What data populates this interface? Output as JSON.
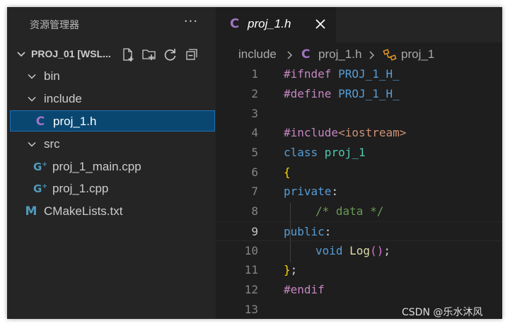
{
  "sidebar": {
    "title": "资源管理器",
    "more_label": "···",
    "section_title": "PROJ_01 [WSL...",
    "tree": [
      {
        "label": "bin",
        "type": "folder",
        "level": 1
      },
      {
        "label": "include",
        "type": "folder",
        "level": 1
      },
      {
        "label": "proj_1.h",
        "type": "c",
        "icon": "C",
        "level": 2,
        "selected": true
      },
      {
        "label": "src",
        "type": "folder",
        "level": 1
      },
      {
        "label": "proj_1_main.cpp",
        "type": "cpp",
        "icon": "G",
        "level": 2
      },
      {
        "label": "proj_1.cpp",
        "type": "cpp",
        "icon": "G",
        "level": 2
      },
      {
        "label": "CMakeLists.txt",
        "type": "cmake",
        "icon": "M",
        "level": 1
      }
    ]
  },
  "editor": {
    "tab": {
      "icon": "C",
      "label": "proj_1.h"
    },
    "breadcrumb": {
      "folder": "include",
      "file_icon": "C",
      "file": "proj_1.h",
      "symbol": "proj_1"
    },
    "current_line": 9,
    "lines": [
      {
        "n": "1"
      },
      {
        "n": "2"
      },
      {
        "n": "3"
      },
      {
        "n": "4"
      },
      {
        "n": "5"
      },
      {
        "n": "6"
      },
      {
        "n": "7"
      },
      {
        "n": "8"
      },
      {
        "n": "9"
      },
      {
        "n": "10"
      },
      {
        "n": "11"
      },
      {
        "n": "12"
      },
      {
        "n": "13"
      }
    ],
    "code": {
      "l1_pre": "#ifndef",
      "l1_mac": " PROJ_1_H_",
      "l2_pre": "#define",
      "l2_mac": " PROJ_1_H_",
      "l4_pre": "#include",
      "l4_str": "<iostream>",
      "l5_kw": "class",
      "l5_type": " proj_1",
      "l6_br": "{",
      "l7_kw": "private",
      "l7_colon": ":",
      "l8_com": "/* data */",
      "l9_kw": "public",
      "l9_colon": ":",
      "l10_kw": "void",
      "l10_fn": " Log",
      "l10_paren": "()",
      "l10_semi": ";",
      "l11_br": "}",
      "l11_semi": ";",
      "l12_pre": "#endif"
    }
  },
  "watermark": "CSDN @乐水沐风"
}
